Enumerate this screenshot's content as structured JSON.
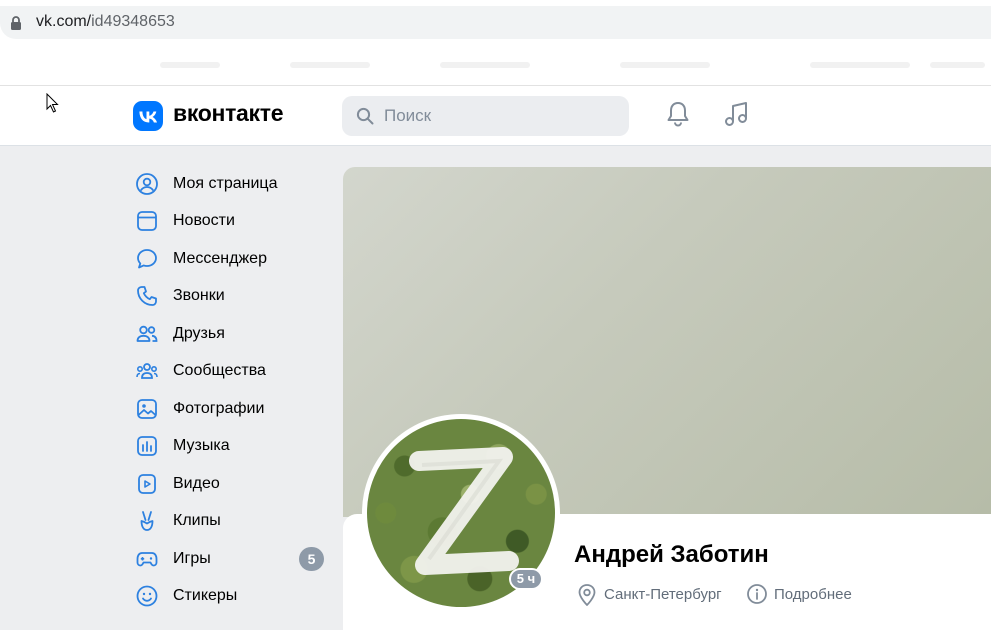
{
  "browser": {
    "url_host": "vk.com/",
    "url_path": "id49348653"
  },
  "header": {
    "logo_text": "вконтакте",
    "search_placeholder": "Поиск"
  },
  "sidebar": {
    "items": [
      {
        "label": "Моя страница",
        "icon": "user-circle-icon"
      },
      {
        "label": "Новости",
        "icon": "news-icon"
      },
      {
        "label": "Мессенджер",
        "icon": "message-icon"
      },
      {
        "label": "Звонки",
        "icon": "phone-icon"
      },
      {
        "label": "Друзья",
        "icon": "friends-icon"
      },
      {
        "label": "Сообщества",
        "icon": "communities-icon"
      },
      {
        "label": "Фотографии",
        "icon": "photo-icon"
      },
      {
        "label": "Музыка",
        "icon": "music-icon"
      },
      {
        "label": "Видео",
        "icon": "video-icon"
      },
      {
        "label": "Клипы",
        "icon": "clips-icon"
      },
      {
        "label": "Игры",
        "icon": "games-icon",
        "badge": "5"
      },
      {
        "label": "Стикеры",
        "icon": "smile-icon"
      }
    ]
  },
  "profile": {
    "name": "Андрей Заботин",
    "city": "Санкт-Петербург",
    "more_label": "Подробнее",
    "last_seen": "5 ч"
  },
  "colors": {
    "vk_blue": "#0077ff",
    "icon_blue": "#2d81e0",
    "secondary_text": "#626d7a",
    "badge_gray": "#8e9aa8"
  }
}
